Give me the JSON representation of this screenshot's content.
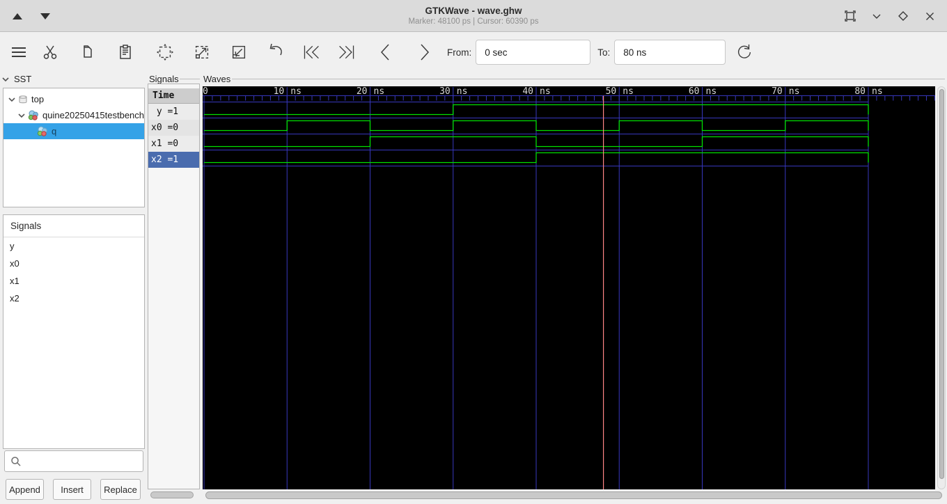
{
  "window": {
    "title": "GTKWave - wave.ghw",
    "subtitle": "Marker: 48100 ps  |  Cursor: 60390 ps"
  },
  "toolbar": {
    "from_label": "From:",
    "from_value": "0 sec",
    "to_label": "To:",
    "to_value": "80 ns"
  },
  "sst": {
    "label": "SST",
    "tree": [
      {
        "label": "top",
        "icon": "hierarchy-cylinder"
      },
      {
        "label": "quine20250415testbench",
        "icon": "module-spheres"
      },
      {
        "label": "q",
        "icon": "module-spheres",
        "selected": true
      }
    ]
  },
  "signals_panel": {
    "label": "Signals",
    "items": [
      "y",
      "x0",
      "x1",
      "x2"
    ]
  },
  "filter_buttons": {
    "append": "Append",
    "insert": "Insert",
    "replace": "Replace"
  },
  "signal_list": {
    "frame_label": "Signals",
    "header": "Time",
    "rows": [
      {
        "text": " y =1",
        "selected": false
      },
      {
        "text": "x0 =0",
        "selected": false
      },
      {
        "text": "x1 =0",
        "selected": false
      },
      {
        "text": "x2 =1",
        "selected": true
      }
    ]
  },
  "waves": {
    "frame_label": "Waves"
  },
  "chart_data": {
    "type": "digital-waveform",
    "time_unit": "ns",
    "x_range": [
      0,
      80
    ],
    "major_ticks": [
      0,
      10,
      20,
      30,
      40,
      50,
      60,
      70,
      80
    ],
    "minor_tick_ns": 1,
    "minor_tick_end_ns": 88,
    "marker_time_ns": 48.1,
    "marker_label_ps": "48100 ps",
    "cursor_label_ps": "60390 ps",
    "signals": [
      {
        "name": "y",
        "value_at_marker": 1,
        "transitions": [
          [
            0,
            0
          ],
          [
            30,
            1
          ],
          [
            80,
            0
          ]
        ]
      },
      {
        "name": "x0",
        "value_at_marker": 0,
        "transitions": [
          [
            0,
            0
          ],
          [
            10,
            1
          ],
          [
            20,
            0
          ],
          [
            30,
            1
          ],
          [
            40,
            0
          ],
          [
            50,
            1
          ],
          [
            60,
            0
          ],
          [
            70,
            1
          ],
          [
            80,
            0
          ]
        ]
      },
      {
        "name": "x1",
        "value_at_marker": 0,
        "transitions": [
          [
            0,
            0
          ],
          [
            20,
            1
          ],
          [
            40,
            0
          ],
          [
            60,
            1
          ],
          [
            80,
            0
          ]
        ]
      },
      {
        "name": "x2",
        "value_at_marker": 1,
        "transitions": [
          [
            0,
            0
          ],
          [
            40,
            1
          ],
          [
            80,
            0
          ]
        ]
      }
    ],
    "colors": {
      "bg": "#000000",
      "trace": "#00e000",
      "grid": "#3737bd",
      "ruler_text": "#d8d8d8",
      "marker": "#ff8585",
      "selected_row": "#4a6cae",
      "tree_selection": "#35a2e7"
    }
  }
}
